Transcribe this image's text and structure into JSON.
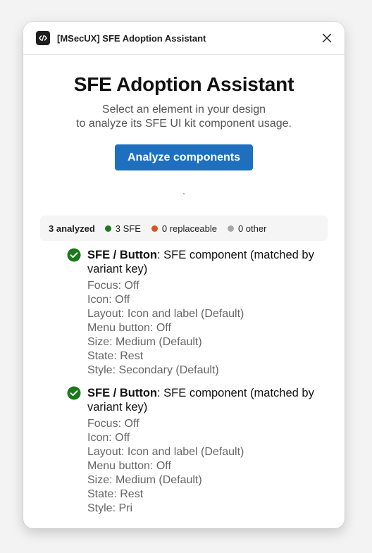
{
  "window": {
    "title": "[MSecUX] SFE Adoption Assistant",
    "app_icon": "code-brackets-icon",
    "close_icon": "close-icon"
  },
  "main": {
    "heading": "SFE Adoption Assistant",
    "subtitle_line1": "Select an element in your design",
    "subtitle_line2": "to analyze its SFE UI kit component usage.",
    "analyze_button": "Analyze components"
  },
  "summary": {
    "count_label": "3 analyzed",
    "legend": [
      {
        "label": "3 SFE",
        "color": "#1a7a1a"
      },
      {
        "label": "0 replaceable",
        "color": "#d9541e"
      },
      {
        "label": "0 other",
        "color": "#a6a6a6"
      }
    ]
  },
  "results": [
    {
      "name": "SFE / Button",
      "desc": ": SFE component (matched by variant key)",
      "status_icon": "check-circle-icon",
      "props": [
        "Focus: Off",
        "Icon: Off",
        "Layout: Icon and label (Default)",
        "Menu button: Off",
        "Size: Medium (Default)",
        "State: Rest",
        "Style: Secondary (Default)"
      ]
    },
    {
      "name": "SFE / Button",
      "desc": ": SFE component (matched by variant key)",
      "status_icon": "check-circle-icon",
      "props": [
        "Focus: Off",
        "Icon: Off",
        "Layout: Icon and label (Default)",
        "Menu button: Off",
        "Size: Medium (Default)",
        "State: Rest",
        "Style: Pri"
      ]
    }
  ],
  "colors": {
    "accent": "#1f6fbf",
    "success": "#1a7a1a"
  }
}
